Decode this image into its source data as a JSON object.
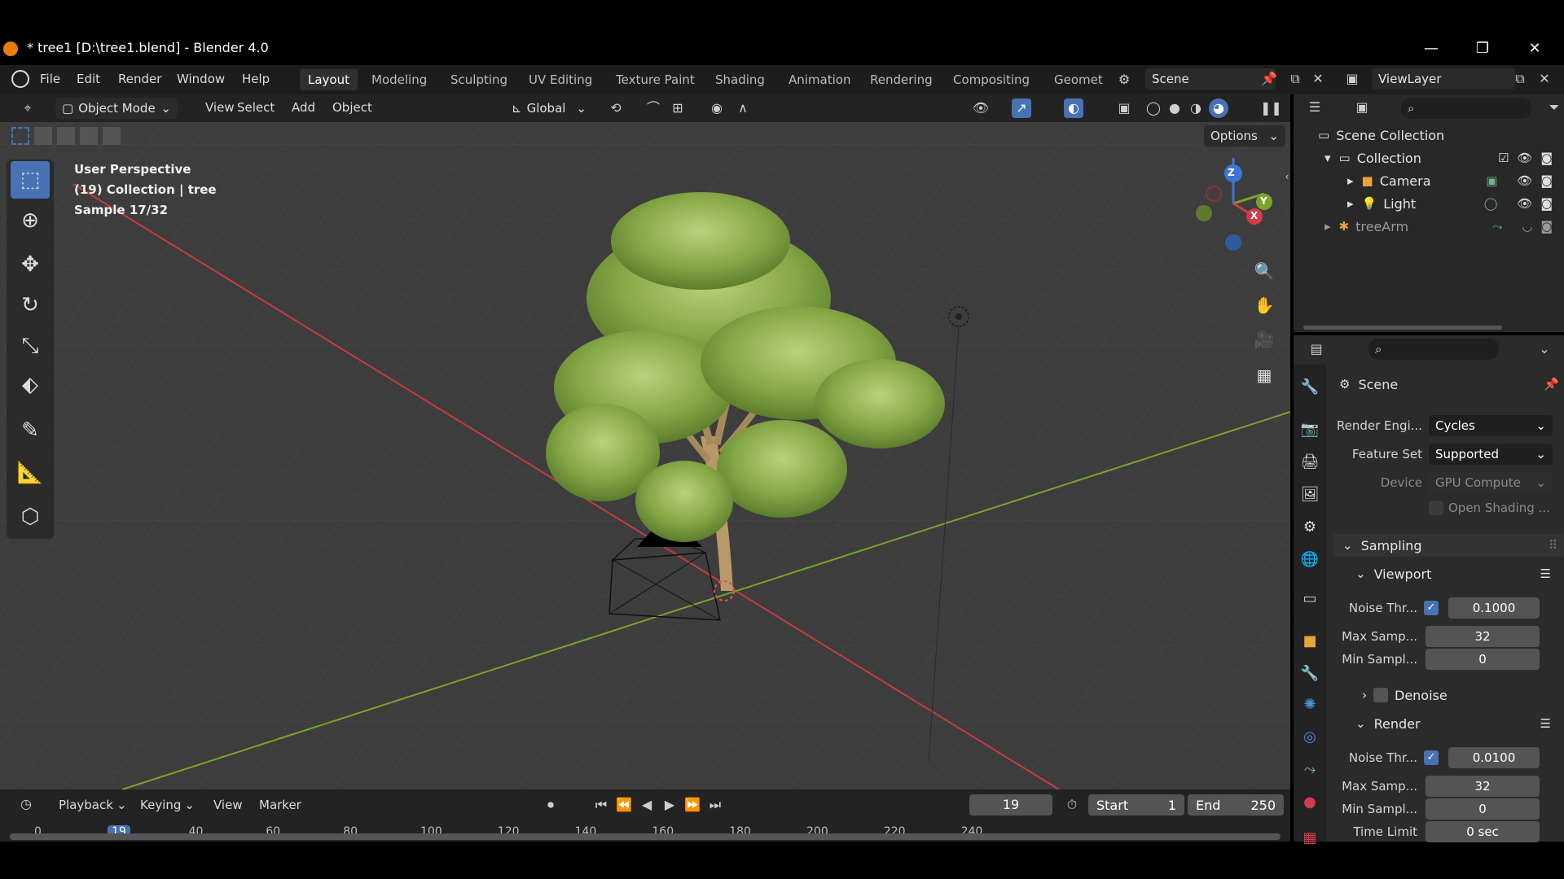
{
  "titlebar": {
    "title": "* tree1 [D:\\tree1.blend] - Blender 4.0",
    "minimize": "—",
    "maximize": "❐",
    "close": "✕"
  },
  "menu": {
    "items": [
      "File",
      "Edit",
      "Render",
      "Window",
      "Help"
    ],
    "workspaces": [
      "Layout",
      "Modeling",
      "Sculpting",
      "UV Editing",
      "Texture Paint",
      "Shading",
      "Animation",
      "Rendering",
      "Compositing",
      "Geomet"
    ],
    "active_workspace": "Layout",
    "scene": "Scene",
    "view_layer": "ViewLayer"
  },
  "viewport_header": {
    "mode": "Object Mode",
    "menus": [
      "View",
      "Select",
      "Add",
      "Object"
    ],
    "transform_orientation": "Global",
    "options": "Options"
  },
  "viewport": {
    "perspective": "User Perspective",
    "collection_info": "(19) Collection | tree",
    "sample": "Sample 17/32",
    "gizmo": {
      "z": "Z",
      "y": "Y",
      "x": "X"
    }
  },
  "toolbar_icons": [
    "select-box-icon",
    "cursor-icon",
    "move-icon",
    "rotate-icon",
    "scale-icon",
    "transform-icon",
    "annotate-icon",
    "measure-icon",
    "add-cube-icon"
  ],
  "timeline": {
    "menus": [
      "Playback",
      "Keying",
      "View",
      "Marker"
    ],
    "current_frame": "19",
    "start_label": "Start",
    "start": "1",
    "end_label": "End",
    "end": "250",
    "ticks": [
      "0",
      "19",
      "40",
      "60",
      "80",
      "100",
      "120",
      "140",
      "160",
      "180",
      "200",
      "220",
      "240"
    ],
    "playhead_frame": 19
  },
  "outliner": {
    "root": "Scene Collection",
    "collection": "Collection",
    "items": [
      "Camera",
      "Light",
      "treeArm"
    ]
  },
  "properties": {
    "context": "Scene",
    "render_engine_label": "Render Engi...",
    "render_engine": "Cycles",
    "feature_set_label": "Feature Set",
    "feature_set": "Supported",
    "device_label": "Device",
    "device": "GPU Compute",
    "open_shading": "Open Shading ...",
    "sampling": "Sampling",
    "viewport_panel": "Viewport",
    "vp_noise_label": "Noise Thr...",
    "vp_noise": "0.1000",
    "vp_max_label": "Max Samp...",
    "vp_max": "32",
    "vp_min_label": "Min Sampl...",
    "vp_min": "0",
    "denoise": "Denoise",
    "render_panel": "Render",
    "r_noise_label": "Noise Thr...",
    "r_noise": "0.0100",
    "r_max_label": "Max Samp...",
    "r_max": "32",
    "r_min_label": "Min Sampl...",
    "r_min": "0",
    "time_limit_label": "Time Limit",
    "time_limit": "0 sec"
  },
  "colors": {
    "accent": "#4772b3",
    "viewport_bg": "#3d3d3d",
    "x_axis": "#c83c3c",
    "y_axis": "#7aa32c",
    "foliage": "#8fb04a",
    "trunk": "#b89a6a"
  }
}
